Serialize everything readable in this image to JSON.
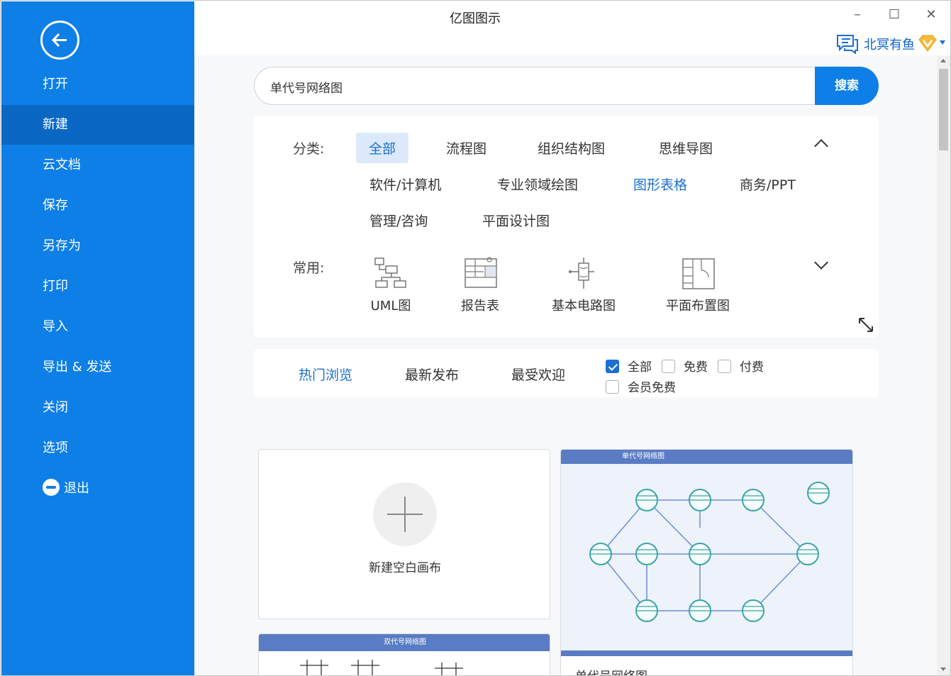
{
  "app": {
    "title": "亿图图示"
  },
  "window_controls": {
    "minimize": "–",
    "maximize": "☐",
    "close": "✕"
  },
  "user": {
    "name": "北冥有鱼"
  },
  "sidebar": {
    "items": [
      {
        "label": "打开"
      },
      {
        "label": "新建",
        "active": true
      },
      {
        "label": "云文档"
      },
      {
        "label": "保存"
      },
      {
        "label": "另存为"
      },
      {
        "label": "打印"
      },
      {
        "label": "导入"
      },
      {
        "label": "导出 & 发送"
      },
      {
        "label": "关闭"
      },
      {
        "label": "选项"
      },
      {
        "label": "退出"
      }
    ]
  },
  "search": {
    "value": "单代号网络图",
    "button": "搜索"
  },
  "categories": {
    "label": "分类:",
    "items": [
      "全部",
      "流程图",
      "组织结构图",
      "思维导图",
      "软件/计算机",
      "专业领域绘图",
      "图形表格",
      "商务/PPT",
      "管理/咨询",
      "平面设计图"
    ],
    "selected": "全部",
    "highlighted": "图形表格"
  },
  "common": {
    "label": "常用:",
    "items": [
      "UML图",
      "报告表",
      "基本电路图",
      "平面布置图"
    ]
  },
  "tabs": [
    "热门浏览",
    "最新发布",
    "最受欢迎"
  ],
  "filters": {
    "all": {
      "label": "全部",
      "checked": true
    },
    "free": {
      "label": "免费",
      "checked": false
    },
    "paid": {
      "label": "付费",
      "checked": false
    },
    "member_free": {
      "label": "会员免费",
      "checked": false
    }
  },
  "cards": {
    "new_blank": "新建空白画布",
    "template1": {
      "header": "单代号网络图",
      "name": "单代号网络图"
    },
    "template2": {
      "header": "双代号网络图"
    }
  },
  "colors": {
    "primary": "#0e7fe6",
    "sidebar_active": "#0a68c4",
    "accent_text": "#1a6fd0",
    "diagram_node": "#3aa6a6"
  }
}
